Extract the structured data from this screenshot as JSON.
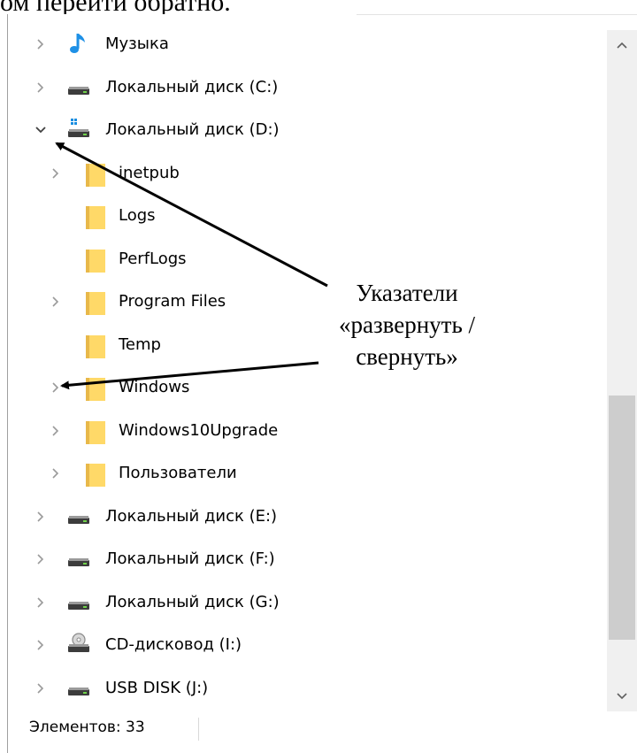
{
  "document": {
    "heading_fragment": "ом перейти обратно."
  },
  "tree": {
    "items": [
      {
        "label": "Музыка",
        "icon": "music-note-icon",
        "expand": "collapsed"
      },
      {
        "label": "Локальный диск (C:)",
        "icon": "drive-icon",
        "expand": "collapsed"
      },
      {
        "label": "Локальный диск (D:)",
        "icon": "windows-drive-icon",
        "expand": "expanded"
      },
      {
        "label": "inetpub",
        "icon": "folder-icon",
        "expand": "collapsed"
      },
      {
        "label": "Logs",
        "icon": "folder-icon",
        "expand": "none"
      },
      {
        "label": "PerfLogs",
        "icon": "folder-icon",
        "expand": "none"
      },
      {
        "label": "Program Files",
        "icon": "folder-icon",
        "expand": "collapsed"
      },
      {
        "label": "Temp",
        "icon": "folder-icon",
        "expand": "none"
      },
      {
        "label": "Windows",
        "icon": "folder-icon",
        "expand": "collapsed"
      },
      {
        "label": "Windows10Upgrade",
        "icon": "folder-icon",
        "expand": "collapsed"
      },
      {
        "label": "Пользователи",
        "icon": "folder-icon",
        "expand": "collapsed"
      },
      {
        "label": "Локальный диск (E:)",
        "icon": "drive-icon",
        "expand": "collapsed"
      },
      {
        "label": "Локальный диск (F:)",
        "icon": "drive-icon",
        "expand": "collapsed"
      },
      {
        "label": "Локальный диск (G:)",
        "icon": "drive-icon",
        "expand": "collapsed"
      },
      {
        "label": "CD-дисковод (I:)",
        "icon": "cd-drive-icon",
        "expand": "collapsed"
      },
      {
        "label": "USB DISK (J:)",
        "icon": "drive-icon",
        "expand": "collapsed"
      }
    ]
  },
  "status": {
    "items_count": "Элементов: 33"
  },
  "annotation": {
    "line1": "Указатели",
    "line2": "«развернуть /",
    "line3": "свернуть»"
  },
  "colors": {
    "folder": "#ffd968",
    "folder_dark": "#e8b84a",
    "music": "#1e90e6",
    "windows_blue": "#1a8de0",
    "chevron": "#9a9a9a",
    "scroll_thumb": "#cdcdcd",
    "scroll_track": "#f0f0f0"
  }
}
